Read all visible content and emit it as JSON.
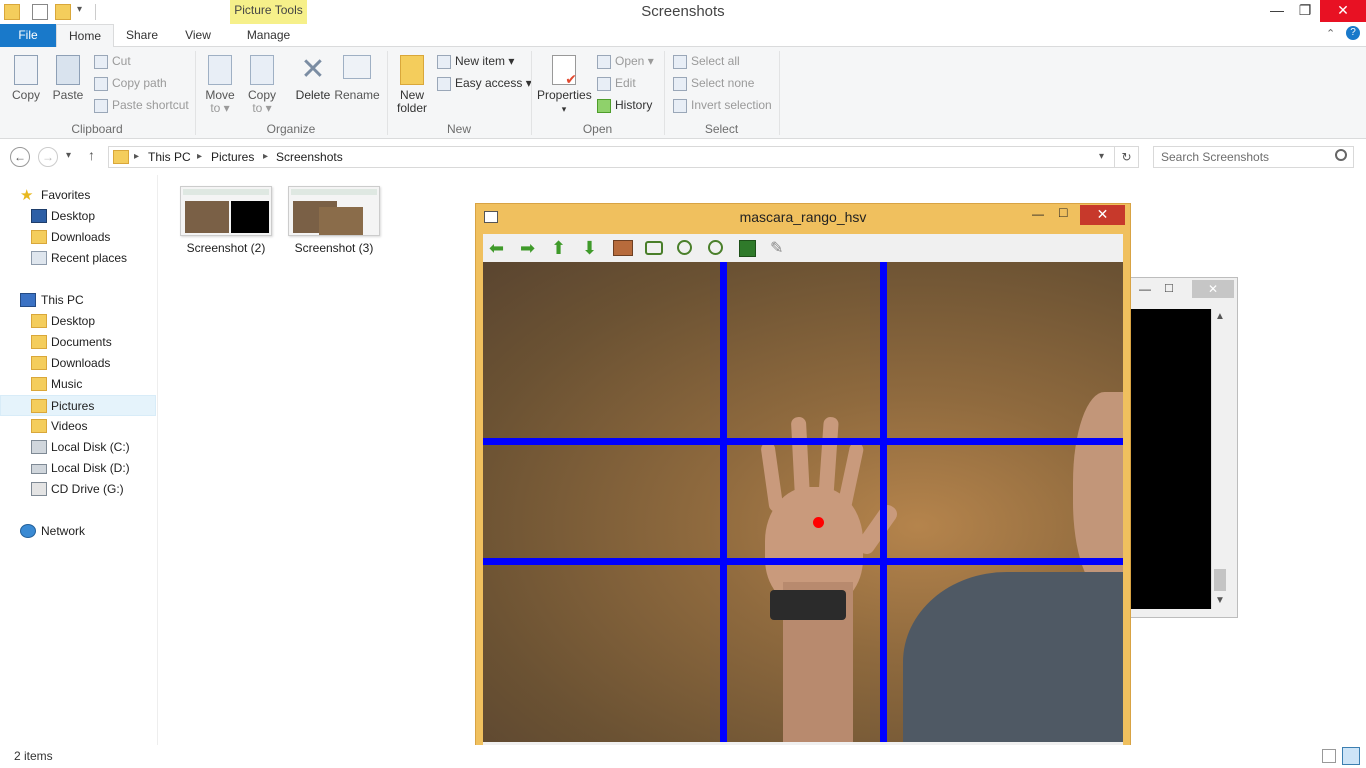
{
  "window": {
    "title": "Screenshots",
    "context_tab": "Picture Tools",
    "min_glyph": "—",
    "max_glyph": "❐",
    "close_glyph": "✕"
  },
  "ribbon_tabs": {
    "file": "File",
    "home": "Home",
    "share": "Share",
    "view": "View",
    "manage": "Manage"
  },
  "clipboard": {
    "copy": "Copy",
    "paste": "Paste",
    "cut": "Cut",
    "copy_path": "Copy path",
    "paste_shortcut": "Paste shortcut",
    "label": "Clipboard"
  },
  "organize": {
    "move_to_1": "Move",
    "move_to_2": "to ▾",
    "copy_to_1": "Copy",
    "copy_to_2": "to ▾",
    "delete": "Delete",
    "rename": "Rename",
    "label": "Organize"
  },
  "new": {
    "new_folder_1": "New",
    "new_folder_2": "folder",
    "new_item": "New item ▾",
    "easy_access": "Easy access ▾",
    "label": "New"
  },
  "open": {
    "properties": "Properties",
    "open": "Open ▾",
    "edit": "Edit",
    "history": "History",
    "label": "Open"
  },
  "select": {
    "select_all": "Select all",
    "select_none": "Select none",
    "invert": "Invert selection",
    "label": "Select"
  },
  "address": {
    "crumbs": [
      "This PC",
      "Pictures",
      "Screenshots"
    ],
    "search_placeholder": "Search Screenshots"
  },
  "nav": {
    "favorites": "Favorites",
    "fav_items": [
      "Desktop",
      "Downloads",
      "Recent places"
    ],
    "this_pc": "This PC",
    "pc_items": [
      "Desktop",
      "Documents",
      "Downloads",
      "Music",
      "Pictures",
      "Videos",
      "Local Disk (C:)",
      "Local Disk (D:)",
      "CD Drive (G:)"
    ],
    "network": "Network"
  },
  "files": [
    {
      "name": "Screenshot (2)"
    },
    {
      "name": "Screenshot (3)"
    }
  ],
  "status": {
    "count": "2 items"
  },
  "image_window": {
    "title": "mascara_rango_hsv",
    "close_glyph": "✕",
    "min_glyph": "—",
    "max_glyph": "□",
    "grid_color": "#0000ff",
    "marker_color": "#ff0000"
  }
}
